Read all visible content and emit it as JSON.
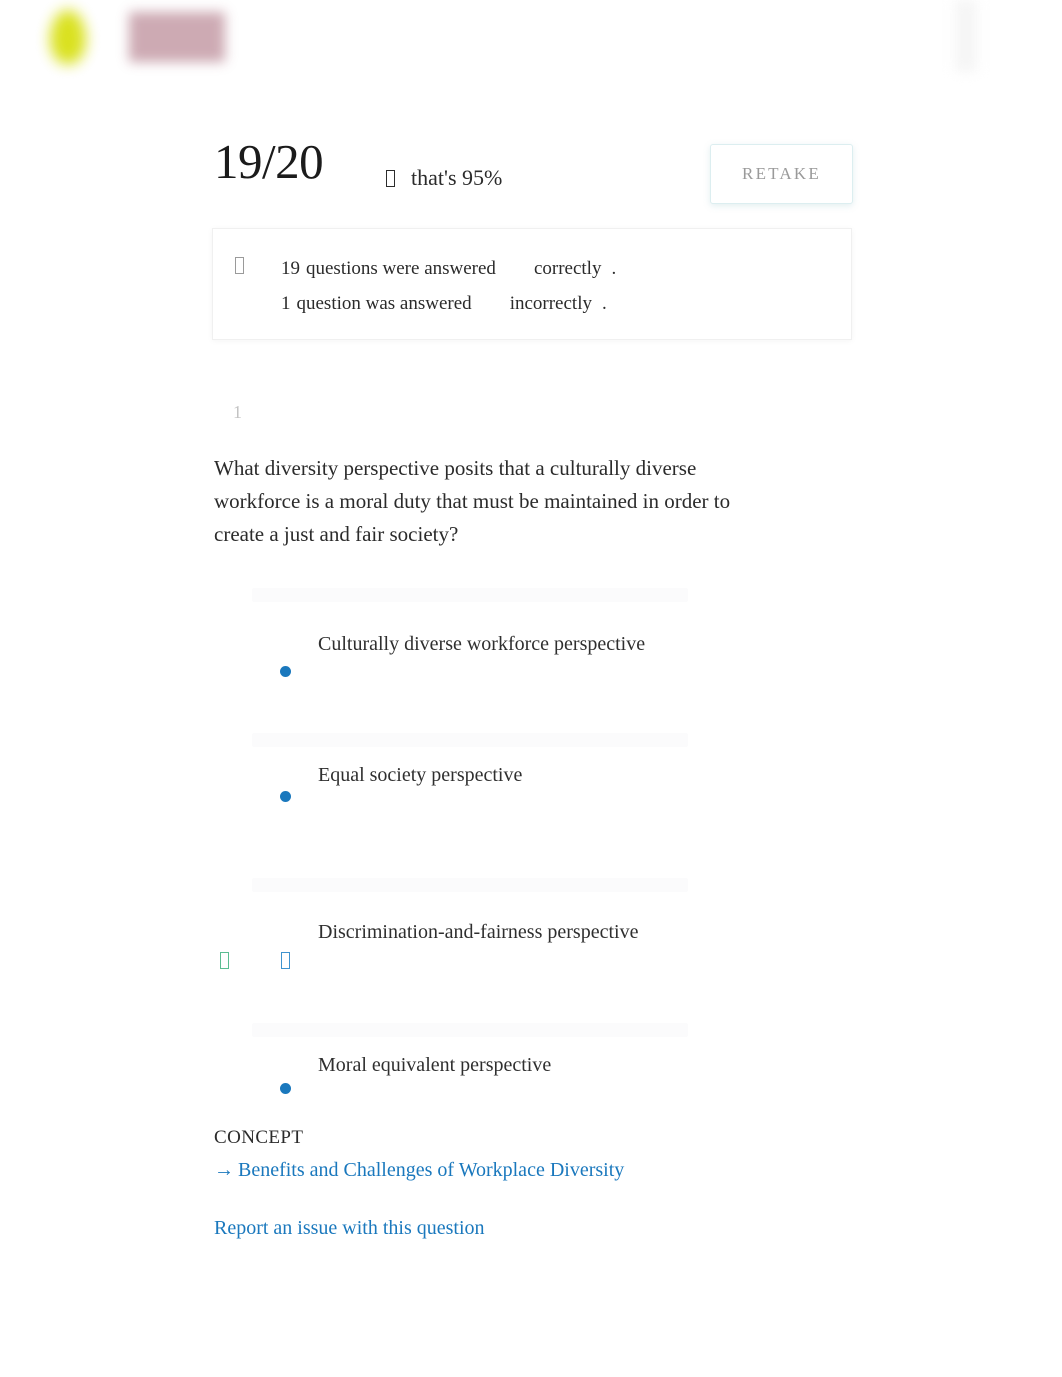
{
  "brand": {
    "logo_icon": "leaf-logo-icon",
    "wordmark_icon": "brand-wordmark-redacted",
    "accent_green": "#d8e015",
    "accent_mauve": "#c9a3ad"
  },
  "results": {
    "score_fraction": "19/20",
    "percent_icon": "square-glyph-icon",
    "percent_text": "that's 95%",
    "retake_label": "RETAKE"
  },
  "summary": {
    "icon": "square-glyph-icon",
    "lines": [
      {
        "count": "19",
        "middle": "questions were answered",
        "verdict": "correctly",
        "period": "."
      },
      {
        "count": "1",
        "middle": "question was answered",
        "verdict": "incorrectly",
        "period": "."
      }
    ]
  },
  "question": {
    "number": "1",
    "text": "What diversity perspective posits that a culturally diverse workforce is a moral duty that must be maintained in order to create a just and fair society?",
    "options": [
      {
        "label": "Culturally diverse workforce perspective",
        "radio_icon": "radio-filled-icon",
        "marker_icon": "",
        "selected": false,
        "correct": false
      },
      {
        "label": "Equal society perspective",
        "radio_icon": "radio-filled-icon",
        "marker_icon": "",
        "selected": false,
        "correct": false
      },
      {
        "label": "Discrimination-and-fairness perspective",
        "radio_icon": "square-glyph-blue-icon",
        "marker_icon": "square-glyph-green-icon",
        "selected": true,
        "correct": true
      },
      {
        "label": "Moral equivalent perspective",
        "radio_icon": "radio-filled-icon",
        "marker_icon": "",
        "selected": false,
        "correct": false
      }
    ]
  },
  "footer": {
    "concept_heading": "CONCEPT",
    "concept_arrow": "→",
    "concept_link": "Benefits and Challenges of Workplace Diversity",
    "report_link": "Report an issue with this question"
  },
  "colors": {
    "link_blue": "#1a78bd",
    "radio_blue": "#1a78bd",
    "correct_green": "#5bbd92",
    "muted_gray": "#9a9a9a"
  }
}
